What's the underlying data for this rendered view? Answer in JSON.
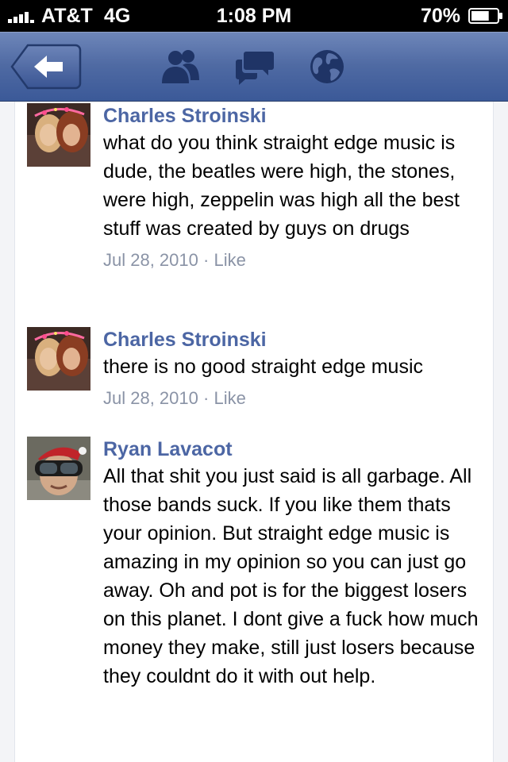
{
  "status_bar": {
    "carrier": "AT&T",
    "network": "4G",
    "time": "1:08 PM",
    "battery": "70%",
    "battery_level": 0.7
  },
  "nav_bar": {
    "back_icon": "back-arrow-icon",
    "icons": [
      "friends-icon",
      "messages-icon",
      "globe-icon"
    ],
    "color": "#3b5998"
  },
  "comments": [
    {
      "author": "Charles Stroinski",
      "text": "what do you think straight edge music is dude, the beatles were high, the stones, were high, zeppelin was high all the best stuff was created by guys on drugs",
      "date": "Jul 28, 2010",
      "separator": "·",
      "like": "Like"
    },
    {
      "author": "Charles Stroinski",
      "text": "there is no good straight edge music",
      "date": "Jul 28, 2010",
      "separator": "·",
      "like": "Like"
    },
    {
      "author": "Ryan Lavacot",
      "text": "All that shit you just said is all garbage. All those bands suck. If you like them thats your opinion. But straight edge music is amazing in my opinion so you can just go away. Oh and pot is for the biggest losers on this planet. I dont give a fuck how much money they make, still just losers because they couldnt do it with out help."
    }
  ]
}
